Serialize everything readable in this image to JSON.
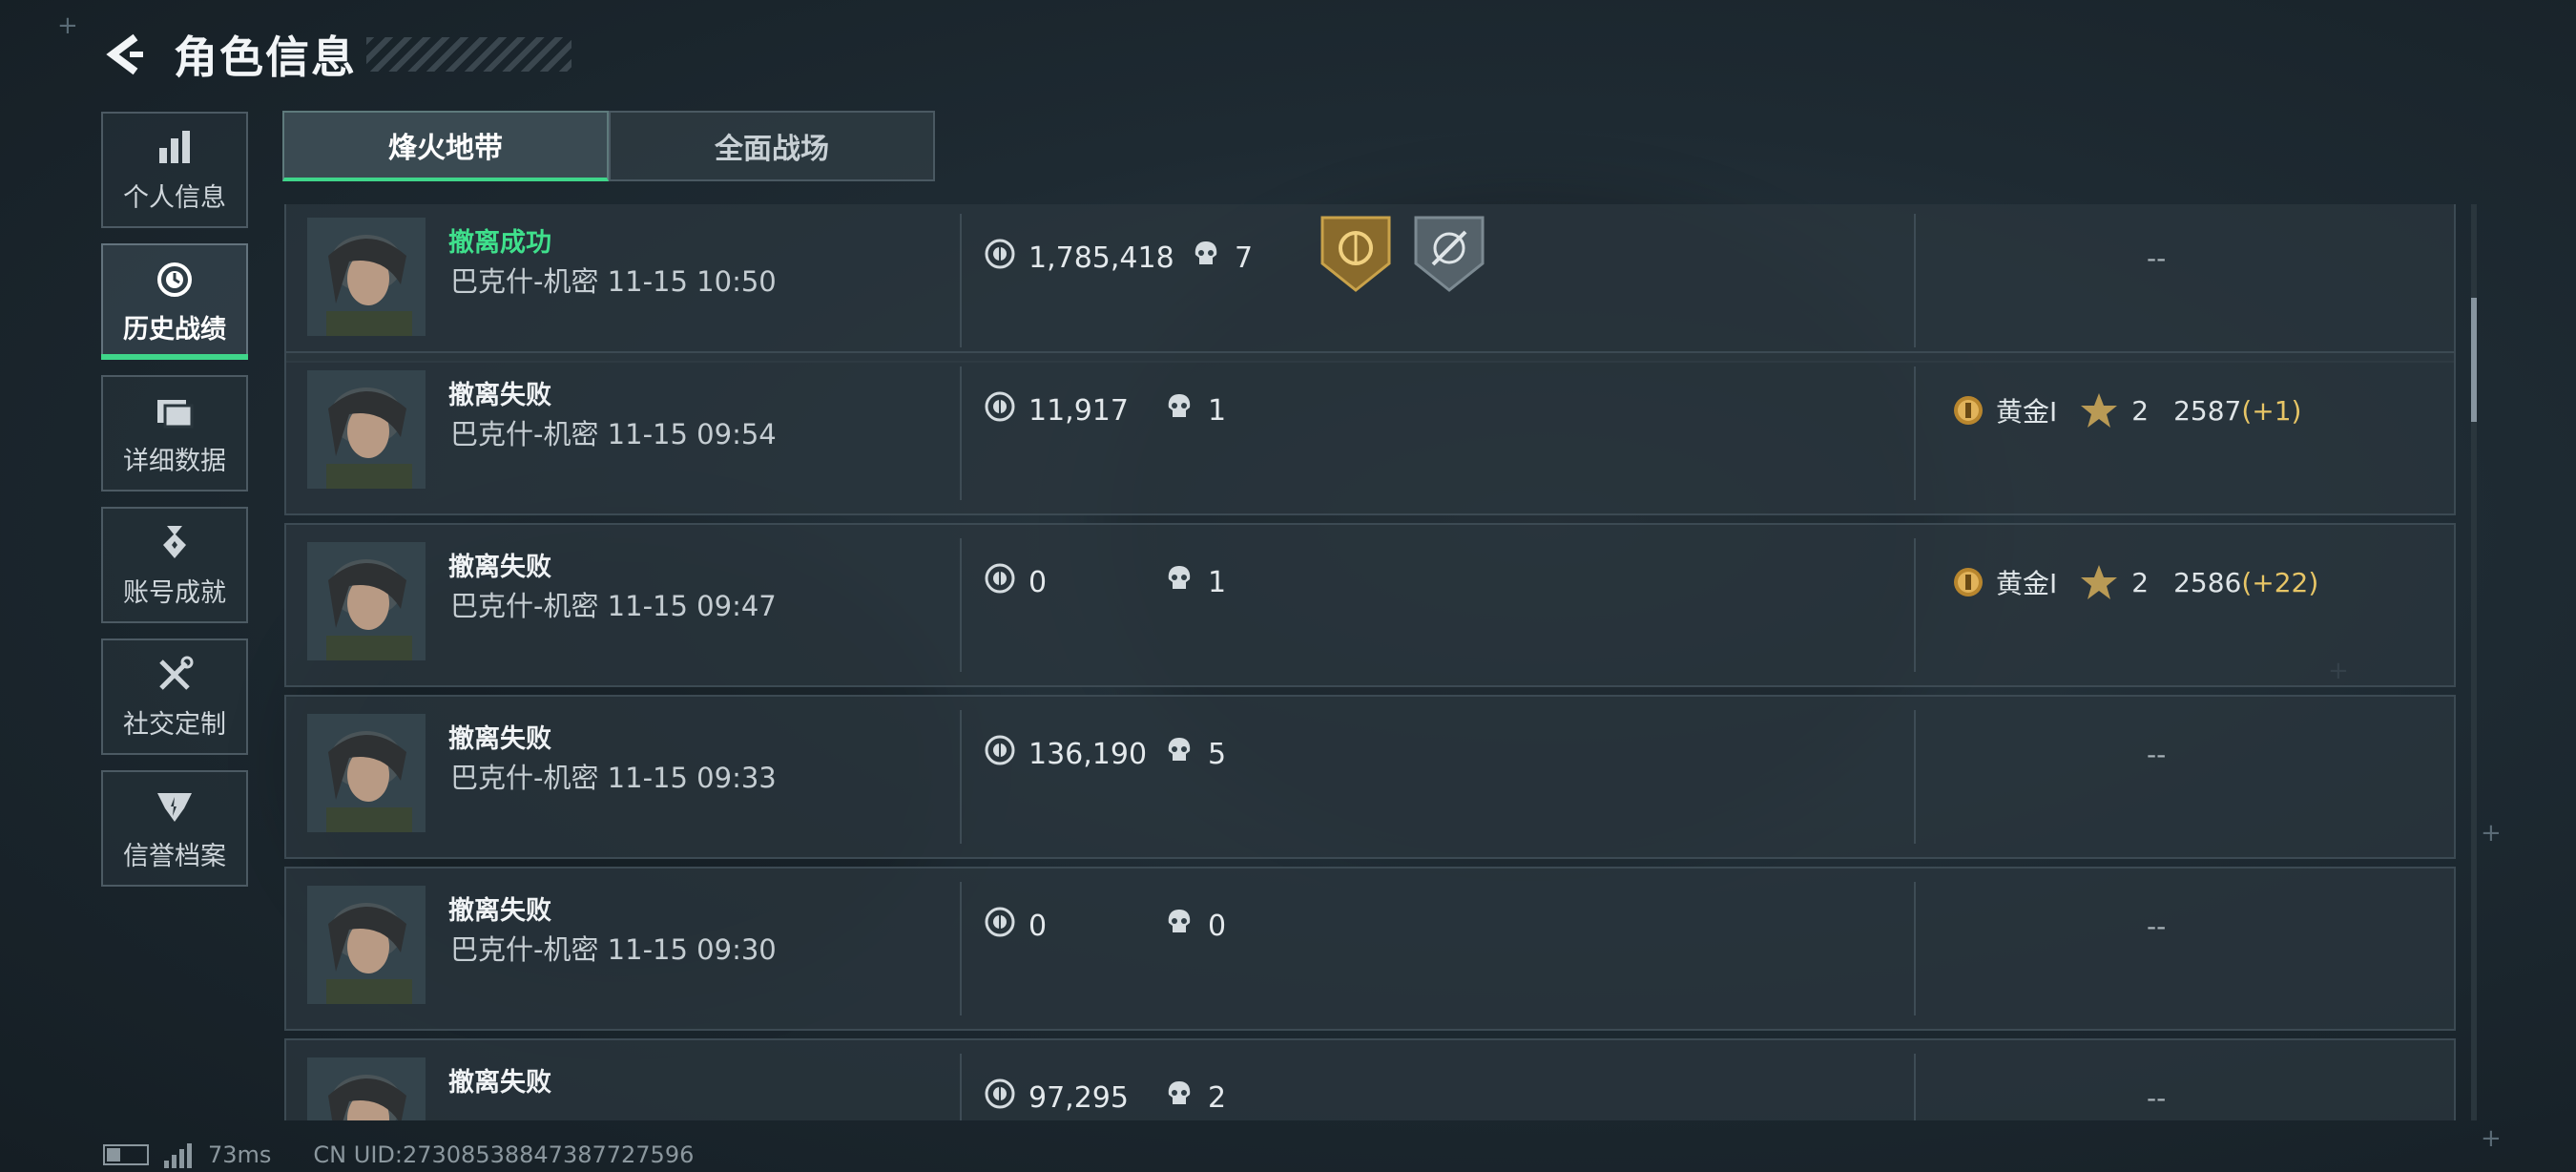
{
  "header": {
    "title": "角色信息"
  },
  "sidebar": {
    "items": [
      {
        "label": "个人信息",
        "icon": "bar-chart-icon"
      },
      {
        "label": "历史战绩",
        "icon": "clock-history-icon",
        "active": true
      },
      {
        "label": "详细数据",
        "icon": "cards-icon"
      },
      {
        "label": "账号成就",
        "icon": "medal-icon"
      },
      {
        "label": "社交定制",
        "icon": "tools-icon"
      },
      {
        "label": "信誉档案",
        "icon": "shield-emblem-icon"
      }
    ]
  },
  "tabs": [
    {
      "label": "烽火地带",
      "active": true
    },
    {
      "label": "全面战场"
    }
  ],
  "matches": [
    {
      "status": "撤离成功",
      "success": true,
      "meta": "巴克什-机密 11-15 10:50",
      "value": "1,785,418",
      "kills": "7",
      "badges": [
        "gold-emblem-badge",
        "crosshair-badge"
      ],
      "rank": null,
      "dash": "--"
    },
    {
      "status": "撤离失败",
      "success": false,
      "meta": "巴克什-机密 11-15 09:54",
      "value": "11,917",
      "kills": "1",
      "badges": [],
      "rank": {
        "tier": "黄金Ⅰ",
        "stars": "2",
        "score": "2587",
        "delta": "(+1)"
      },
      "dash": ""
    },
    {
      "status": "撤离失败",
      "success": false,
      "meta": "巴克什-机密 11-15 09:47",
      "value": "0",
      "kills": "1",
      "badges": [],
      "rank": {
        "tier": "黄金Ⅰ",
        "stars": "2",
        "score": "2586",
        "delta": "(+22)"
      },
      "dash": ""
    },
    {
      "status": "撤离失败",
      "success": false,
      "meta": "巴克什-机密 11-15 09:33",
      "value": "136,190",
      "kills": "5",
      "badges": [],
      "rank": null,
      "dash": "--"
    },
    {
      "status": "撤离失败",
      "success": false,
      "meta": "巴克什-机密 11-15 09:30",
      "value": "0",
      "kills": "0",
      "badges": [],
      "rank": null,
      "dash": "--"
    },
    {
      "status": "撤离失败",
      "success": false,
      "meta": "",
      "value": "97,295",
      "kills": "2",
      "badges": [],
      "rank": null,
      "dash": "--"
    }
  ],
  "footer": {
    "ping": "73ms",
    "uid": "CN UID:2730853884738772759​6"
  },
  "colors": {
    "accent_green": "#3fd68a",
    "gold": "#e7c566"
  }
}
